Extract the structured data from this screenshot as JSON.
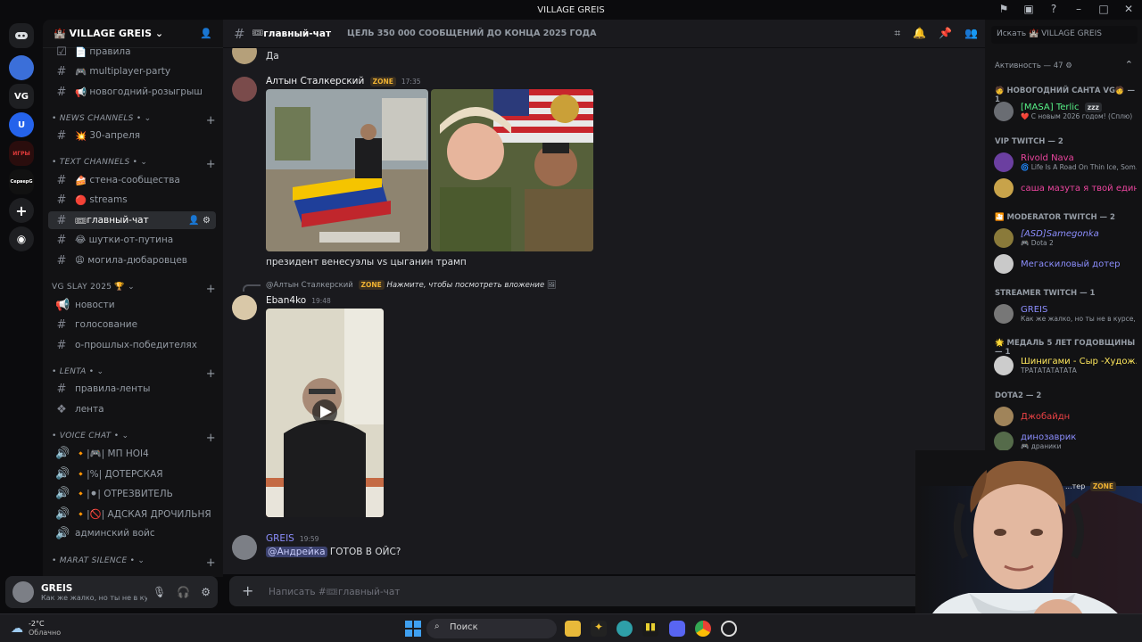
{
  "window": {
    "title": "VILLAGE GREIS"
  },
  "servers": [
    {
      "label": "",
      "color": "#5865f2"
    },
    {
      "label": "VG",
      "color": "#1e1f22"
    },
    {
      "label": "U",
      "color": "#2563eb"
    },
    {
      "label": "ИГРЫ",
      "color": "#1e1f22"
    },
    {
      "label": "СерверG",
      "color": "#1e1f22"
    }
  ],
  "sidebar": {
    "guild_name": "VILLAGE GREIS",
    "top_channels": [
      {
        "name": "правила",
        "emoji": "📄"
      },
      {
        "name": "multiplayer-party",
        "emoji": "🎮"
      },
      {
        "name": "новогодний-розыгрыш",
        "emoji": "📢"
      }
    ],
    "categories": [
      {
        "name": "NEWS CHANNELS",
        "channels": [
          {
            "name": "30-апреля",
            "emoji": "💥"
          }
        ]
      },
      {
        "name": "TEXT CHANNELS",
        "channels": [
          {
            "name": "стена-сообщества",
            "emoji": "🍰"
          },
          {
            "name": "streams",
            "emoji": "🔴"
          },
          {
            "name": "главный-чат",
            "emoji": "🎟"
          },
          {
            "name": "шутки-от-путина",
            "emoji": "😂"
          },
          {
            "name": "могила-дюбаровцев",
            "emoji": "😩"
          }
        ]
      },
      {
        "name": "VG SLAY 2025",
        "channels": [
          {
            "name": "новости"
          },
          {
            "name": "голосование"
          },
          {
            "name": "о-прошлых-победителях"
          }
        ]
      },
      {
        "name": "LENTA",
        "channels": [
          {
            "name": "правила-ленты"
          },
          {
            "name": "лента"
          }
        ]
      },
      {
        "name": "VOICE CHAT",
        "channels": [
          {
            "name": "🔸|🎮| МП HOI4"
          },
          {
            "name": "🔸|%| ДОТЕРСКАЯ"
          },
          {
            "name": "🔸|⚫| ОТРЕЗВИТЕЛЬ"
          },
          {
            "name": "🔸|🚫| АДСКАЯ ДРОЧИЛЬНЯ"
          },
          {
            "name": "админский войс"
          }
        ]
      },
      {
        "name": "MARAT SILENCE",
        "channels": []
      }
    ]
  },
  "user_panel": {
    "name": "GREIS",
    "status": "Как же жалко, но ты не в курс..."
  },
  "chat": {
    "channel_title": "главный-чат",
    "topic": "ЦЕЛЬ 350 000 СООБЩЕНИЙ ДО КОНЦА 2025 ГОДА",
    "messages": [
      {
        "author": "",
        "time": "",
        "text": "Да"
      },
      {
        "author": "Алтын Сталкерский",
        "badge": "ZONE",
        "time": "17:35",
        "text": "президент венесуэлы vs цыганин трамп"
      },
      {
        "reply_to": "@Алтын Сталкерский",
        "reply_badge": "ZONE",
        "reply_text": "Нажмите, чтобы посмотреть вложение",
        "author": "Eban4ko",
        "time": "19:48",
        "text": ""
      },
      {
        "author": "GREIS",
        "time": "19:59",
        "mention": "@Андрейка",
        "text": "ГОТОВ В ОЙС?"
      }
    ],
    "composer_placeholder": "Написать #🎟главный-чат"
  },
  "members": {
    "search_placeholder": "Искать 🏰 VILLAGE GREIS",
    "activity_label": "Активность — 47",
    "groups": [
      {
        "title": "🧑 НОВОГОДНИЙ САНТА VG🧑 — 1",
        "members": [
          {
            "name": "[MASA] Terlic",
            "tag": "zzz",
            "status": "❤️ С новым 2026 годом! (Сплю)",
            "color": "#57f287"
          }
        ]
      },
      {
        "title": "VIP TWITCH — 2",
        "members": [
          {
            "name": "Rivold Nava",
            "status": "🌀 Life Is A Road On Thin Ice, Som...",
            "color": "#eb459e"
          },
          {
            "name": "саша мазута я твой един...",
            "status": "",
            "color": "#eb459e"
          }
        ]
      },
      {
        "title": "🎦 MODERATOR TWITCH — 2",
        "members": [
          {
            "name": "[ASD]Samegonka",
            "status": "🎮 Dota 2",
            "color": "#8b8dfc"
          },
          {
            "name": "Мегаскиловый дотер",
            "status": "",
            "color": "#8b8dfc"
          }
        ]
      },
      {
        "title": "STREAMER TWITCH — 1",
        "members": [
          {
            "name": "GREIS",
            "status": "Как же жалко, но ты не в курсе, к...",
            "color": "#8b8dfc"
          }
        ]
      },
      {
        "title": "🌟 МЕДАЛЬ 5 ЛЕТ ГОДОВЩИНЫ — 1",
        "members": [
          {
            "name": "Шинигами - Сыр -Худож...",
            "status": "ТРАТАТАТАТАТА",
            "color": "#fee75c"
          }
        ]
      },
      {
        "title": "DOTA2 — 2",
        "members": [
          {
            "name": "Джобайдн",
            "status": "",
            "color": "#ed4245"
          },
          {
            "name": "динозаврик",
            "status": "🎮 драники",
            "color": "#8b8dfc"
          }
        ]
      }
    ],
    "partial_row": {
      "name": "...тер",
      "badge": "ZONE"
    }
  },
  "taskbar": {
    "weather_temp": "-2°C",
    "weather_desc": "Облачно",
    "search_label": "Поиск"
  },
  "colors": {
    "accent": "#5865f2",
    "bg": "#1a1a1e",
    "sidebar": "#121214"
  }
}
